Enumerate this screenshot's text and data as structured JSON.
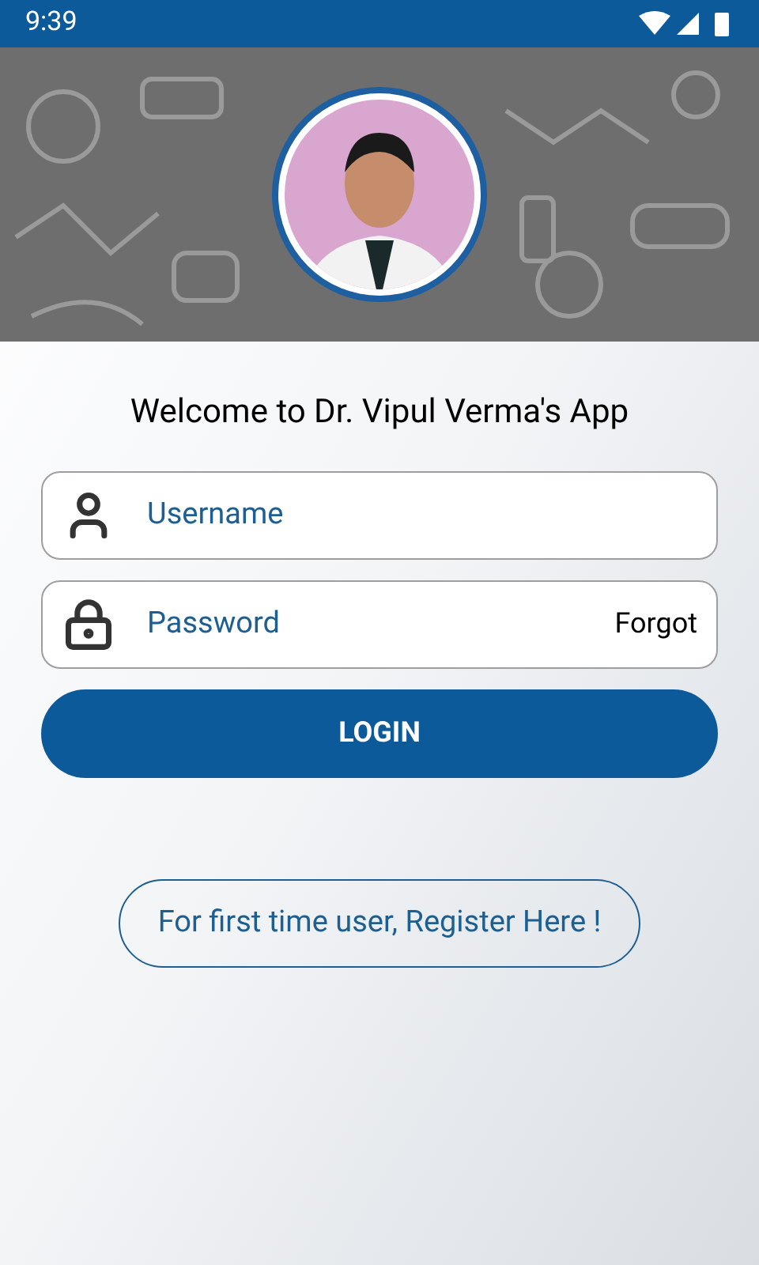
{
  "status_bar": {
    "time": "9:39"
  },
  "title": "Welcome to Dr. Vipul Verma's App",
  "username": {
    "placeholder": "Username"
  },
  "password": {
    "placeholder": "Password",
    "forgot": "Forgot"
  },
  "login_button": "LOGIN",
  "register_button": "For first time user, Register Here !"
}
